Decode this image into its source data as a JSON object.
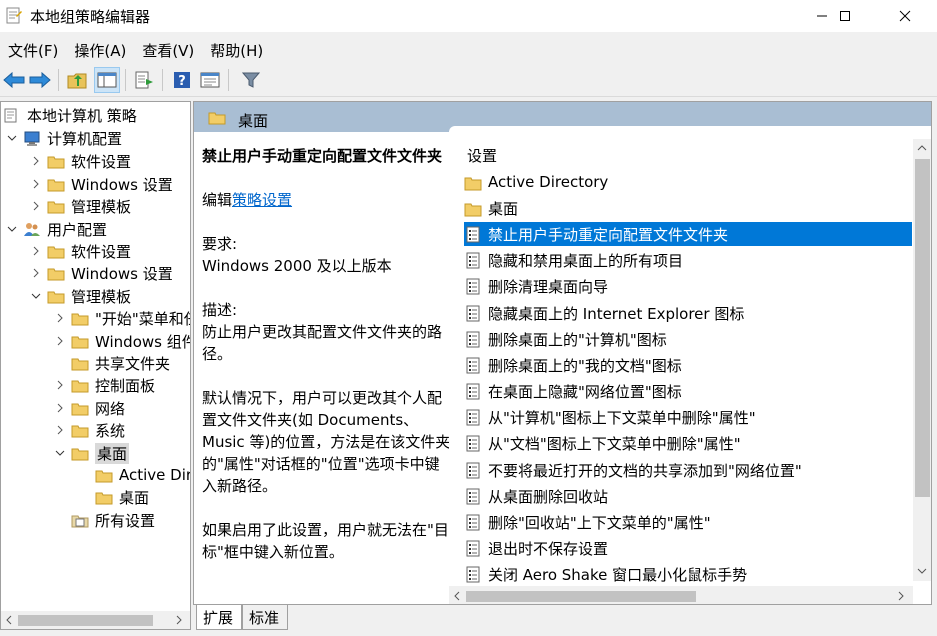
{
  "window": {
    "title": "本地组策略编辑器"
  },
  "menu": [
    "文件(F)",
    "操作(A)",
    "查看(V)",
    "帮助(H)"
  ],
  "tree": {
    "items": [
      {
        "label": "本地计算机 策略"
      },
      {
        "label": "计算机配置"
      },
      {
        "label": "软件设置"
      },
      {
        "label": "Windows 设置"
      },
      {
        "label": "管理模板"
      },
      {
        "label": "用户配置"
      },
      {
        "label": "软件设置"
      },
      {
        "label": "Windows 设置"
      },
      {
        "label": "管理模板"
      },
      {
        "label": "\"开始\"菜单和任务栏"
      },
      {
        "label": "Windows 组件"
      },
      {
        "label": "共享文件夹"
      },
      {
        "label": "控制面板"
      },
      {
        "label": "网络"
      },
      {
        "label": "系统"
      },
      {
        "label": "桌面"
      },
      {
        "label": "Active Directory"
      },
      {
        "label": "桌面"
      },
      {
        "label": "所有设置"
      }
    ]
  },
  "details": {
    "header": "桌面",
    "policy_title": "禁止用户手动重定向配置文件文件夹",
    "edit_prefix": "编辑",
    "edit_link": "策略设置",
    "req_label": "要求:",
    "req_value": "Windows 2000 及以上版本",
    "desc_label": "描述:",
    "desc_value": "防止用户更改其配置文件文件夹的路径。",
    "desc_para2": "默认情况下，用户可以更改其个人配置文件文件夹(如 Documents、Music 等)的位置，方法是在该文件夹的\"属性\"对话框的\"位置\"选项卡中键入新路径。",
    "desc_para3": "如果启用了此设置，用户就无法在\"目标\"框中键入新位置。"
  },
  "list": {
    "column": "设置",
    "items": [
      {
        "label": "Active Directory",
        "icon": "folder-icon"
      },
      {
        "label": "桌面",
        "icon": "folder-icon"
      },
      {
        "label": "禁止用户手动重定向配置文件文件夹",
        "icon": "setting-icon",
        "selected": true
      },
      {
        "label": "隐藏和禁用桌面上的所有项目",
        "icon": "setting-icon"
      },
      {
        "label": "删除清理桌面向导",
        "icon": "setting-icon"
      },
      {
        "label": "隐藏桌面上的 Internet Explorer 图标",
        "icon": "setting-icon"
      },
      {
        "label": "删除桌面上的\"计算机\"图标",
        "icon": "setting-icon"
      },
      {
        "label": "删除桌面上的\"我的文档\"图标",
        "icon": "setting-icon"
      },
      {
        "label": "在桌面上隐藏\"网络位置\"图标",
        "icon": "setting-icon"
      },
      {
        "label": "从\"计算机\"图标上下文菜单中删除\"属性\"",
        "icon": "setting-icon"
      },
      {
        "label": "从\"文档\"图标上下文菜单中删除\"属性\"",
        "icon": "setting-icon"
      },
      {
        "label": "不要将最近打开的文档的共享添加到\"网络位置\"",
        "icon": "setting-icon"
      },
      {
        "label": "从桌面删除回收站",
        "icon": "setting-icon"
      },
      {
        "label": "删除\"回收站\"上下文菜单的\"属性\"",
        "icon": "setting-icon"
      },
      {
        "label": "退出时不保存设置",
        "icon": "setting-icon"
      },
      {
        "label": "关闭 Aero Shake 窗口最小化鼠标手势",
        "icon": "setting-icon"
      }
    ]
  },
  "tabs": [
    "扩展",
    "标准"
  ],
  "colors": {
    "selection": "#0078d7",
    "header_bg": "#a9bed3",
    "link": "#0066cc"
  }
}
